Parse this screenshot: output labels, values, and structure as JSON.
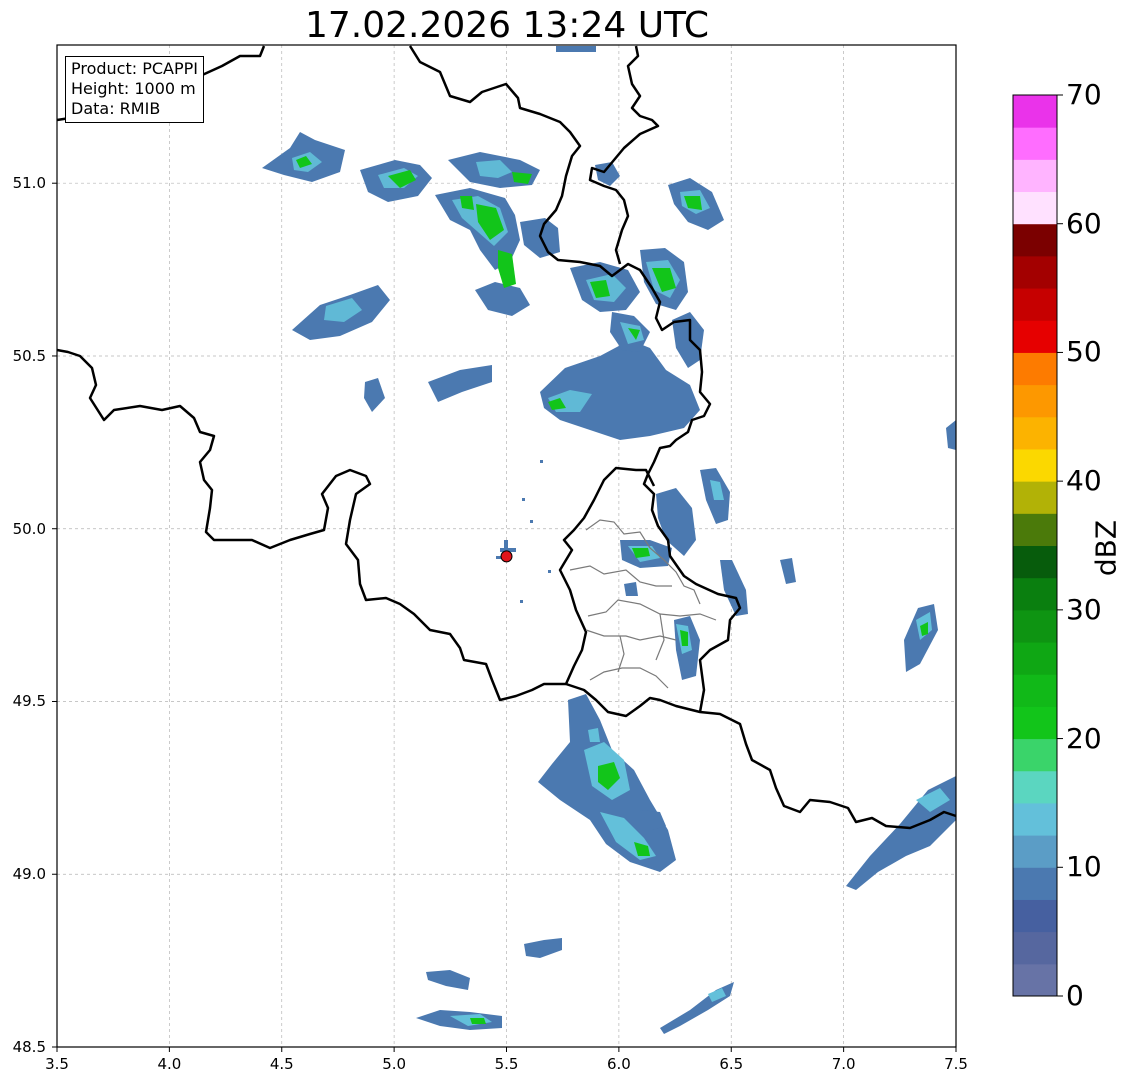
{
  "title": "17.02.2026 13:24 UTC",
  "info": {
    "product": "Product: PCAPPI",
    "height": "Height: 1000 m",
    "data": "Data: RMIB"
  },
  "axes": {
    "x_ticks": [
      "3.5",
      "4.0",
      "4.5",
      "5.0",
      "5.5",
      "6.0",
      "6.5",
      "7.0",
      "7.5"
    ],
    "y_ticks": [
      "48.5",
      "49.0",
      "49.5",
      "50.0",
      "50.5",
      "51.0"
    ],
    "xlim": [
      3.5,
      7.5
    ],
    "ylim": [
      48.5,
      51.4
    ],
    "grid": true
  },
  "radar_site": {
    "lon": 5.5,
    "lat": 49.92,
    "marker_color": "#e0141b"
  },
  "colorbar": {
    "label": "dBZ",
    "ticks": [
      "0",
      "10",
      "20",
      "30",
      "40",
      "50",
      "60",
      "70"
    ],
    "range": [
      0,
      70
    ],
    "colors": [
      "#6773a6",
      "#56679f",
      "#4660a0",
      "#4b79b0",
      "#5b9dc6",
      "#63c0da",
      "#5bd6c0",
      "#3ad46a",
      "#12c51a",
      "#11b918",
      "#0fa714",
      "#0e9412",
      "#0a7f0f",
      "#075c0c",
      "#4b7a0a",
      "#b2b206",
      "#fbd800",
      "#fcb300",
      "#fd9800",
      "#fd7b00",
      "#e60000",
      "#c60000",
      "#a30000",
      "#7b0000",
      "#ffe1ff",
      "#ffb4ff",
      "#ff6dff",
      "#ea33ea"
    ]
  }
}
